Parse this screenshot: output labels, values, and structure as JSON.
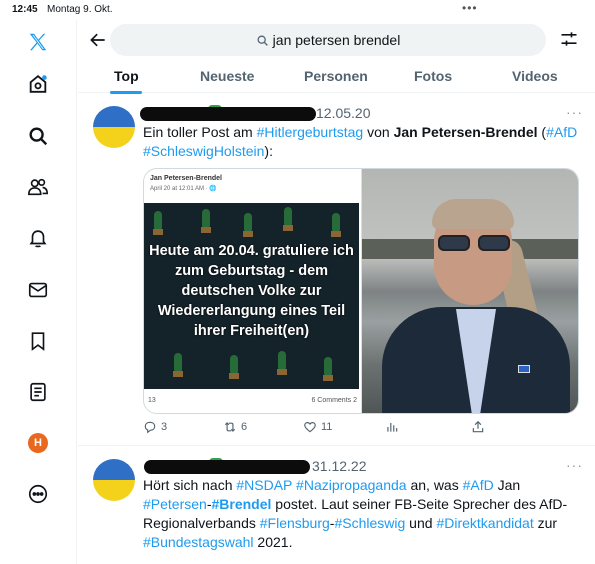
{
  "status": {
    "time": "12:45",
    "date": "Montag 9. Okt.",
    "dots": "•••"
  },
  "sidebar": {
    "icons": [
      "x-logo-icon",
      "home-icon",
      "search-icon",
      "people-icon",
      "bell-icon",
      "mail-icon",
      "bookmark-icon",
      "list-icon",
      "profile-avatar",
      "more-circle-icon"
    ],
    "avatar_letter": "H",
    "avatar_color": "#e8681f"
  },
  "search": {
    "query": "jan petersen brendel"
  },
  "tabs": [
    {
      "label": "Top",
      "active": true
    },
    {
      "label": "Neueste",
      "active": false
    },
    {
      "label": "Personen",
      "active": false
    },
    {
      "label": "Fotos",
      "active": false
    },
    {
      "label": "Videos",
      "active": false
    }
  ],
  "accent_color": "#1d9bf0",
  "tweets": [
    {
      "date": "12.05.20",
      "more": "···",
      "text": {
        "t1": "Ein toller Post am ",
        "h1": "#Hitlergeburtstag",
        "t2": " von ",
        "name": "Jan Petersen-Brendel",
        "t3": " (",
        "h2": "#AfD",
        "h3": "#SchleswigHolstein",
        "t4": "):"
      },
      "media": {
        "fb_name": "Jan Petersen-Brendel",
        "fb_sub": "April 20 at 12:01 AM · 🌐",
        "caption": "Heute am 20.04. gratuliere ich zum Geburtstag - dem deutschen Volke zur Wiedererlangung eines Teil ihrer Freiheit(en)",
        "foot_left": "13",
        "foot_right": "6 Comments  2"
      },
      "actions": {
        "replies": "3",
        "retweets": "6",
        "likes": "11"
      }
    },
    {
      "date": "31.12.22",
      "more": "···",
      "text": {
        "t1": "Hört sich nach ",
        "h1": "#NSDAP",
        "sp1": " ",
        "h2": "#Nazipropaganda",
        "t2": " an, was ",
        "h3": "#AfD",
        "t3": " Jan ",
        "h4": "#Petersen",
        "t4": "-",
        "h5": "#Brendel",
        "t5": " postet. Laut seiner FB-Seite Sprecher des AfD-Regionalverbands ",
        "h6": "#Flensburg",
        "t6": "-",
        "h7": "#Schleswig",
        "t7": " und ",
        "h8": "#Direktkandidat",
        "t8": " zur ",
        "h9": "#Bundestagswahl",
        "t9": " 2021."
      }
    }
  ]
}
